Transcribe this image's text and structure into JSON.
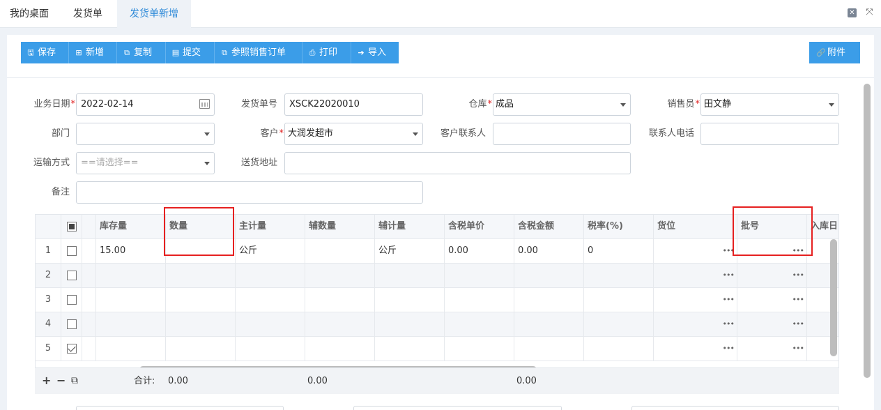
{
  "tabs": [
    {
      "label": "我的桌面",
      "active": false
    },
    {
      "label": "发货单",
      "active": false
    },
    {
      "label": "发货单新增",
      "active": true
    }
  ],
  "window_controls": {
    "close_icon": "✕",
    "fullscreen_icon": "⤧"
  },
  "toolbar": {
    "buttons": [
      {
        "icon": "save-icon",
        "glyph": "🖫",
        "label": "保存"
      },
      {
        "icon": "add-icon",
        "glyph": "⊞",
        "label": "新增"
      },
      {
        "icon": "copy-icon",
        "glyph": "⧉",
        "label": "复制"
      },
      {
        "icon": "submit-icon",
        "glyph": "▤",
        "label": "提交"
      },
      {
        "icon": "reference-icon",
        "glyph": "⧉",
        "label": "参照销售订单"
      },
      {
        "icon": "print-icon",
        "glyph": "⎙",
        "label": "打印"
      },
      {
        "icon": "import-icon",
        "glyph": "➔",
        "label": "导入"
      }
    ],
    "attach": {
      "icon": "link-icon",
      "glyph": "🔗",
      "label": "附件"
    }
  },
  "form": {
    "business_date": {
      "label": "业务日期",
      "value": "2022-02-14"
    },
    "order_no": {
      "label": "发货单号",
      "value": "XSCK22020010"
    },
    "warehouse": {
      "label": "仓库",
      "value": "成品"
    },
    "salesperson": {
      "label": "销售员",
      "value": "田文静"
    },
    "department": {
      "label": "部门",
      "value": ""
    },
    "customer": {
      "label": "客户",
      "value": "大润发超市"
    },
    "customer_contact": {
      "label": "客户联系人",
      "value": ""
    },
    "contact_phone": {
      "label": "联系人电话",
      "value": ""
    },
    "transport": {
      "label": "运输方式",
      "value": "",
      "placeholder": "==请选择=="
    },
    "address": {
      "label": "送货地址",
      "value": ""
    },
    "remark": {
      "label": "备注",
      "value": ""
    },
    "required_mark": "*"
  },
  "grid": {
    "columns": [
      "库存量",
      "数量",
      "主计量",
      "辅数量",
      "辅计量",
      "含税单价",
      "含税金额",
      "税率(%)",
      "货位",
      "批号",
      "入库日"
    ],
    "rows": [
      {
        "num": "1",
        "checked": false,
        "cells": [
          "15.00",
          "",
          "公斤",
          "",
          "公斤",
          "0.00",
          "0.00",
          "0",
          "",
          "",
          ""
        ]
      },
      {
        "num": "2",
        "checked": false,
        "cells": [
          "",
          "",
          "",
          "",
          "",
          "",
          "",
          "",
          "",
          "",
          ""
        ]
      },
      {
        "num": "3",
        "checked": false,
        "cells": [
          "",
          "",
          "",
          "",
          "",
          "",
          "",
          "",
          "",
          "",
          ""
        ]
      },
      {
        "num": "4",
        "checked": false,
        "cells": [
          "",
          "",
          "",
          "",
          "",
          "",
          "",
          "",
          "",
          "",
          ""
        ]
      },
      {
        "num": "5",
        "checked": true,
        "cells": [
          "",
          "",
          "",
          "",
          "",
          "",
          "",
          "",
          "",
          "",
          ""
        ]
      }
    ],
    "ellipsis": "•••"
  },
  "footer": {
    "add_icon": "+",
    "remove_icon": "−",
    "copy_icon": "⧉",
    "total_label": "合计:",
    "total_qty": "0.00",
    "total_aux": "0.00",
    "total_amount": "0.00"
  }
}
